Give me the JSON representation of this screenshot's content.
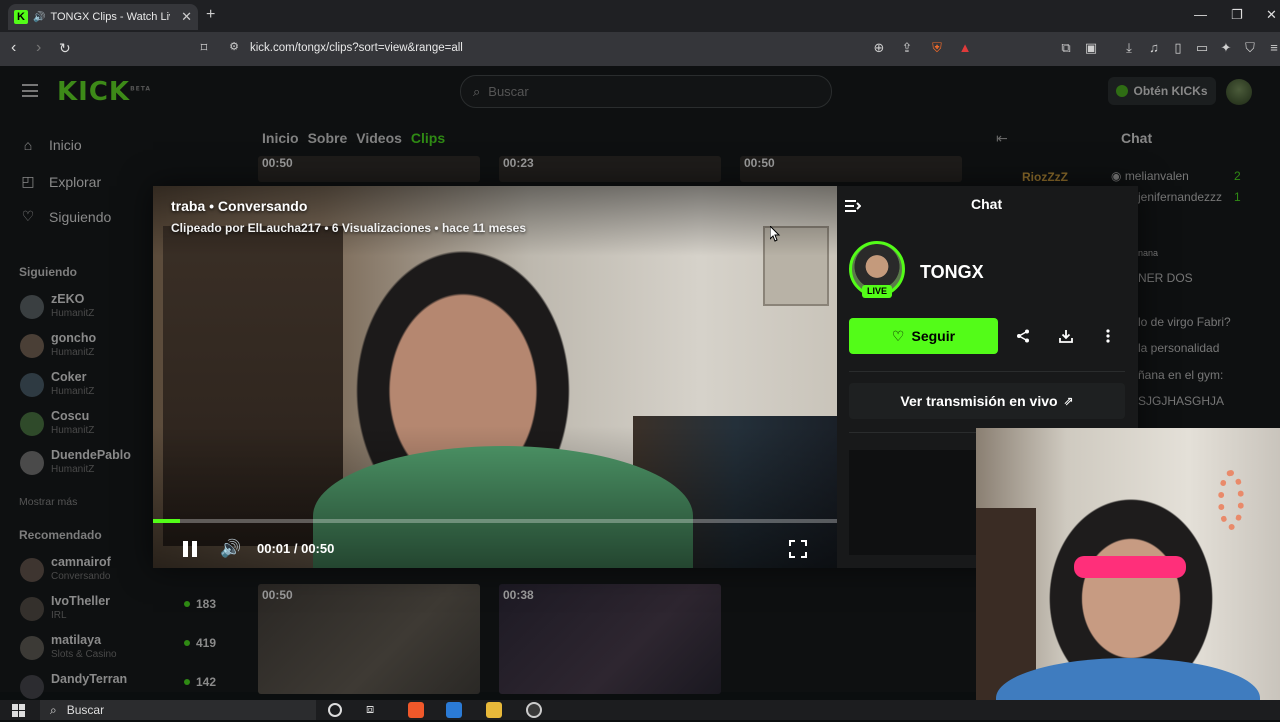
{
  "browser": {
    "tab_title": "TONGX Clips - Watch Live on",
    "tab_close": "✕",
    "new_tab": "+",
    "url": "kick.com/tongx/clips?sort=view&range=all"
  },
  "site": {
    "logo": "KICK",
    "logo_sup": "BETA",
    "search_placeholder": "Buscar",
    "get_kicks": "Obtén KICKs"
  },
  "sidebar": {
    "nav": [
      {
        "label": "Inicio",
        "icon": "home-icon"
      },
      {
        "label": "Explorar",
        "icon": "compass-icon"
      },
      {
        "label": "Siguiendo",
        "icon": "heart-icon"
      }
    ],
    "following_heading": "Siguiendo",
    "following": [
      {
        "name": "zEKO",
        "sub": "HumanitZ"
      },
      {
        "name": "goncho",
        "sub": "HumanitZ"
      },
      {
        "name": "Coker",
        "sub": "HumanitZ"
      },
      {
        "name": "Coscu",
        "sub": "HumanitZ"
      },
      {
        "name": "DuendePablo",
        "sub": "HumanitZ"
      }
    ],
    "show_more": "Mostrar más",
    "recommended_heading": "Recomendado",
    "recommended": [
      {
        "name": "camnairof",
        "sub": "Conversando",
        "viewers": ""
      },
      {
        "name": "IvoTheller",
        "sub": "IRL",
        "viewers": "183"
      },
      {
        "name": "matilaya",
        "sub": "Slots & Casino",
        "viewers": "419"
      },
      {
        "name": "DandyTerran",
        "sub": "",
        "viewers": "142"
      }
    ]
  },
  "channel": {
    "tabs": [
      "Inicio",
      "Sobre",
      "Videos",
      "Clips"
    ],
    "active_tab": "Clips",
    "clip_durations_top": [
      "00:50",
      "00:23",
      "00:50"
    ],
    "clip_durations_bottom": [
      "00:50",
      "00:38"
    ]
  },
  "bg_chat": {
    "title": "Chat",
    "messages": [
      {
        "user": "RiozZzZ",
        "text": "melianvalen",
        "count": "2"
      },
      {
        "user": "",
        "text": "jenifernandezzz",
        "count": "1"
      },
      {
        "user": "",
        "text": "nana",
        "count": ""
      },
      {
        "user": "",
        "text": "NER DOS",
        "count": ""
      },
      {
        "user": "",
        "text": "lo de virgo Fabri?",
        "count": ""
      },
      {
        "user": "",
        "text": "la personalidad",
        "count": ""
      },
      {
        "user": "",
        "text": "ñana en el gym:",
        "count": ""
      },
      {
        "user": "",
        "text": "SJGJHASGHJA",
        "count": ""
      }
    ]
  },
  "clip_modal": {
    "title": "traba • Conversando",
    "meta": "Clipeado por ElLaucha217 • 6 Visualizaciones • hace 11 meses",
    "time": "00:01 / 00:50",
    "progress_fraction": 0.04,
    "panel_title": "Chat",
    "streamer": "TONGX",
    "live_badge": "LIVE",
    "follow": "Seguir",
    "watch_live": "Ver transmisión en vivo"
  },
  "taskbar": {
    "search": "Buscar"
  },
  "colors": {
    "kick_green": "#53fc18",
    "page_bg": "#0e1011",
    "modal_bg": "#18191a"
  }
}
